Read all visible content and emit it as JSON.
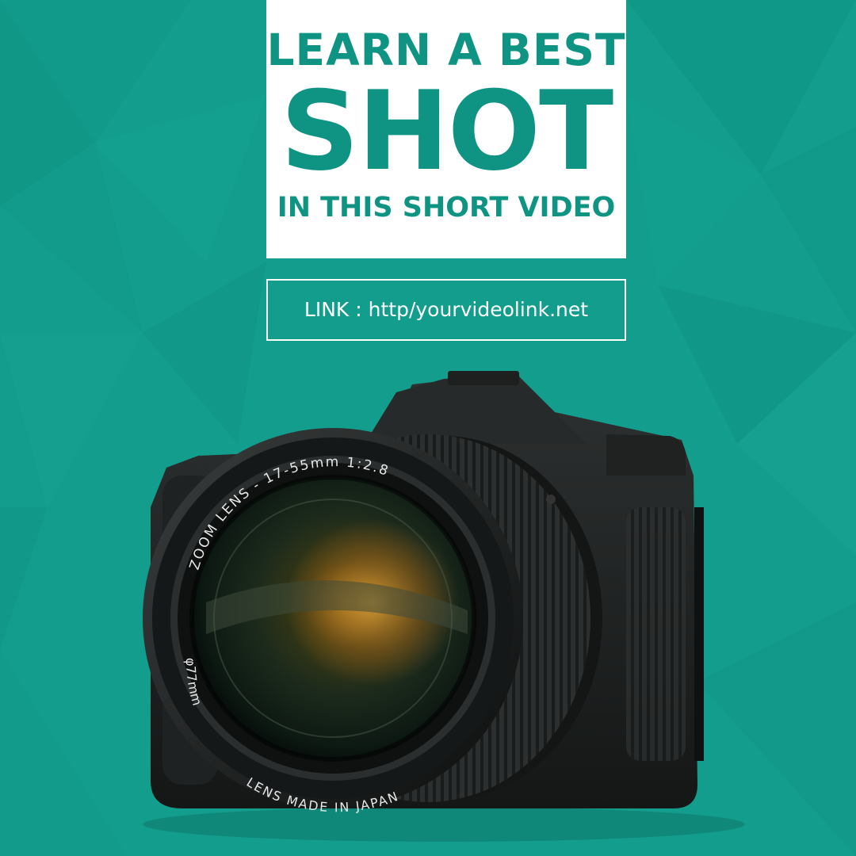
{
  "headline": {
    "line1": "LEARN A BEST",
    "line2": "SHOT",
    "line3": "IN THIS SHORT VIDEO"
  },
  "link": {
    "text": "LINK : http/yourvideolink.net"
  },
  "camera": {
    "lens_top_text": "ZOOM LENS - 17-55mm 1:2.8",
    "lens_left_text": "φ77mm",
    "lens_bottom_text": "LENS MADE IN JAPAN"
  },
  "colors": {
    "background": "#139d8d",
    "accent": "#0f9484",
    "panel": "#ffffff"
  }
}
